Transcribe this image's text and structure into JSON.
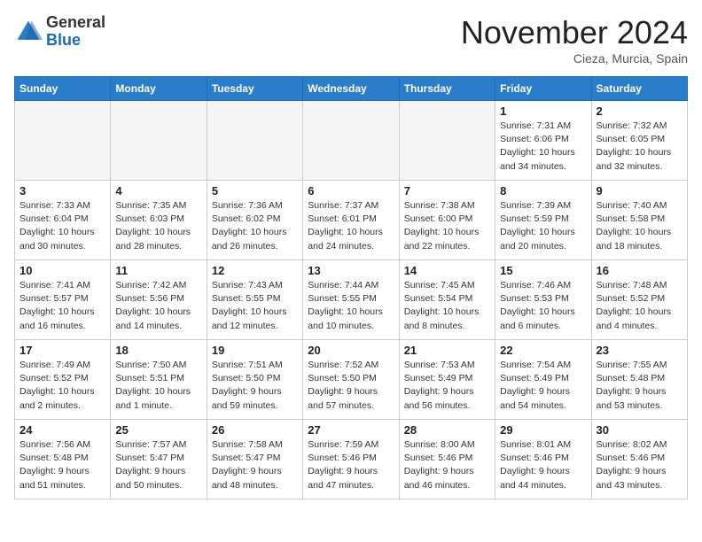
{
  "header": {
    "logo_line1": "General",
    "logo_line2": "Blue",
    "month": "November 2024",
    "location": "Cieza, Murcia, Spain"
  },
  "days_of_week": [
    "Sunday",
    "Monday",
    "Tuesday",
    "Wednesday",
    "Thursday",
    "Friday",
    "Saturday"
  ],
  "weeks": [
    [
      {
        "day": "",
        "info": ""
      },
      {
        "day": "",
        "info": ""
      },
      {
        "day": "",
        "info": ""
      },
      {
        "day": "",
        "info": ""
      },
      {
        "day": "",
        "info": ""
      },
      {
        "day": "1",
        "info": "Sunrise: 7:31 AM\nSunset: 6:06 PM\nDaylight: 10 hours and 34 minutes."
      },
      {
        "day": "2",
        "info": "Sunrise: 7:32 AM\nSunset: 6:05 PM\nDaylight: 10 hours and 32 minutes."
      }
    ],
    [
      {
        "day": "3",
        "info": "Sunrise: 7:33 AM\nSunset: 6:04 PM\nDaylight: 10 hours and 30 minutes."
      },
      {
        "day": "4",
        "info": "Sunrise: 7:35 AM\nSunset: 6:03 PM\nDaylight: 10 hours and 28 minutes."
      },
      {
        "day": "5",
        "info": "Sunrise: 7:36 AM\nSunset: 6:02 PM\nDaylight: 10 hours and 26 minutes."
      },
      {
        "day": "6",
        "info": "Sunrise: 7:37 AM\nSunset: 6:01 PM\nDaylight: 10 hours and 24 minutes."
      },
      {
        "day": "7",
        "info": "Sunrise: 7:38 AM\nSunset: 6:00 PM\nDaylight: 10 hours and 22 minutes."
      },
      {
        "day": "8",
        "info": "Sunrise: 7:39 AM\nSunset: 5:59 PM\nDaylight: 10 hours and 20 minutes."
      },
      {
        "day": "9",
        "info": "Sunrise: 7:40 AM\nSunset: 5:58 PM\nDaylight: 10 hours and 18 minutes."
      }
    ],
    [
      {
        "day": "10",
        "info": "Sunrise: 7:41 AM\nSunset: 5:57 PM\nDaylight: 10 hours and 16 minutes."
      },
      {
        "day": "11",
        "info": "Sunrise: 7:42 AM\nSunset: 5:56 PM\nDaylight: 10 hours and 14 minutes."
      },
      {
        "day": "12",
        "info": "Sunrise: 7:43 AM\nSunset: 5:55 PM\nDaylight: 10 hours and 12 minutes."
      },
      {
        "day": "13",
        "info": "Sunrise: 7:44 AM\nSunset: 5:55 PM\nDaylight: 10 hours and 10 minutes."
      },
      {
        "day": "14",
        "info": "Sunrise: 7:45 AM\nSunset: 5:54 PM\nDaylight: 10 hours and 8 minutes."
      },
      {
        "day": "15",
        "info": "Sunrise: 7:46 AM\nSunset: 5:53 PM\nDaylight: 10 hours and 6 minutes."
      },
      {
        "day": "16",
        "info": "Sunrise: 7:48 AM\nSunset: 5:52 PM\nDaylight: 10 hours and 4 minutes."
      }
    ],
    [
      {
        "day": "17",
        "info": "Sunrise: 7:49 AM\nSunset: 5:52 PM\nDaylight: 10 hours and 2 minutes."
      },
      {
        "day": "18",
        "info": "Sunrise: 7:50 AM\nSunset: 5:51 PM\nDaylight: 10 hours and 1 minute."
      },
      {
        "day": "19",
        "info": "Sunrise: 7:51 AM\nSunset: 5:50 PM\nDaylight: 9 hours and 59 minutes."
      },
      {
        "day": "20",
        "info": "Sunrise: 7:52 AM\nSunset: 5:50 PM\nDaylight: 9 hours and 57 minutes."
      },
      {
        "day": "21",
        "info": "Sunrise: 7:53 AM\nSunset: 5:49 PM\nDaylight: 9 hours and 56 minutes."
      },
      {
        "day": "22",
        "info": "Sunrise: 7:54 AM\nSunset: 5:49 PM\nDaylight: 9 hours and 54 minutes."
      },
      {
        "day": "23",
        "info": "Sunrise: 7:55 AM\nSunset: 5:48 PM\nDaylight: 9 hours and 53 minutes."
      }
    ],
    [
      {
        "day": "24",
        "info": "Sunrise: 7:56 AM\nSunset: 5:48 PM\nDaylight: 9 hours and 51 minutes."
      },
      {
        "day": "25",
        "info": "Sunrise: 7:57 AM\nSunset: 5:47 PM\nDaylight: 9 hours and 50 minutes."
      },
      {
        "day": "26",
        "info": "Sunrise: 7:58 AM\nSunset: 5:47 PM\nDaylight: 9 hours and 48 minutes."
      },
      {
        "day": "27",
        "info": "Sunrise: 7:59 AM\nSunset: 5:46 PM\nDaylight: 9 hours and 47 minutes."
      },
      {
        "day": "28",
        "info": "Sunrise: 8:00 AM\nSunset: 5:46 PM\nDaylight: 9 hours and 46 minutes."
      },
      {
        "day": "29",
        "info": "Sunrise: 8:01 AM\nSunset: 5:46 PM\nDaylight: 9 hours and 44 minutes."
      },
      {
        "day": "30",
        "info": "Sunrise: 8:02 AM\nSunset: 5:46 PM\nDaylight: 9 hours and 43 minutes."
      }
    ]
  ]
}
